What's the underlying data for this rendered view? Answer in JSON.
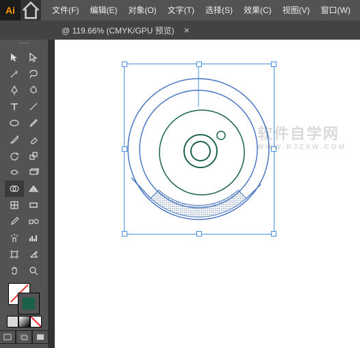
{
  "app": {
    "logo_text": "Ai"
  },
  "menu": {
    "file": "文件(F)",
    "edit": "编辑(E)",
    "object": "对象(O)",
    "type": "文字(T)",
    "select": "选择(S)",
    "effect": "效果(C)",
    "view": "视图(V)",
    "window": "窗口(W)"
  },
  "tab": {
    "title": "@ 119.66%  (CMYK/GPU 预览)",
    "close": "×"
  },
  "tools": {
    "selection": "selection",
    "direct": "direct-selection",
    "wand": "magic-wand",
    "lasso": "lasso",
    "pen": "pen",
    "curvature": "curvature-pen",
    "type": "type",
    "line": "line-segment",
    "rect": "rectangle",
    "brush": "paintbrush",
    "shaper": "shaper",
    "eraser": "eraser",
    "rotate": "rotate",
    "scale": "scale",
    "width": "width",
    "warp": "free-transform",
    "shape_builder": "shape-builder",
    "perspective": "perspective-grid",
    "mesh": "mesh",
    "gradient": "gradient",
    "eyedrop": "eyedropper",
    "blend": "blend",
    "symbol": "symbol-sprayer",
    "graph": "column-graph",
    "artboard": "artboard",
    "slice": "slice",
    "hand": "hand",
    "zoom": "zoom"
  },
  "watermark": {
    "line1": "软件自学网",
    "line2": "WWW.RJZXW.COM"
  }
}
